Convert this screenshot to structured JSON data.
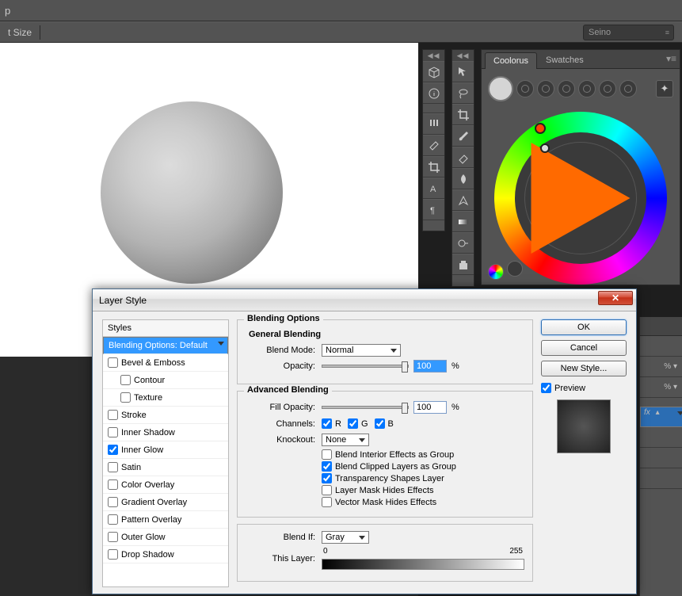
{
  "topbar": {
    "letter": "p",
    "tsize": "t Size"
  },
  "dropdown": {
    "seino": "Seino"
  },
  "panels": {
    "coolorus": "Coolorus",
    "swatches": "Swatches"
  },
  "dialog": {
    "title": "Layer Style",
    "close": "✕",
    "styles_header": "Styles",
    "style_items": {
      "blending": "Blending Options: Default",
      "bevel": "Bevel & Emboss",
      "contour": "Contour",
      "texture": "Texture",
      "stroke": "Stroke",
      "innershadow": "Inner Shadow",
      "innerglow": "Inner Glow",
      "satin": "Satin",
      "coloroverlay": "Color Overlay",
      "gradientoverlay": "Gradient Overlay",
      "patternoverlay": "Pattern Overlay",
      "outerglow": "Outer Glow",
      "dropshadow": "Drop Shadow"
    },
    "blending_options_title": "Blending Options",
    "general_title": "General Blending",
    "blendmode_label": "Blend Mode:",
    "blendmode_value": "Normal",
    "opacity_label": "Opacity:",
    "opacity_value": "100",
    "pct": "%",
    "advanced_title": "Advanced Blending",
    "fillopacity_label": "Fill Opacity:",
    "fillopacity_value": "100",
    "channels_label": "Channels:",
    "ch_r": "R",
    "ch_g": "G",
    "ch_b": "B",
    "knockout_label": "Knockout:",
    "knockout_value": "None",
    "adv1": "Blend Interior Effects as Group",
    "adv2": "Blend Clipped Layers as Group",
    "adv3": "Transparency Shapes Layer",
    "adv4": "Layer Mask Hides Effects",
    "adv5": "Vector Mask Hides Effects",
    "blendif_label": "Blend If:",
    "blendif_value": "Gray",
    "thislayer": "This Layer:",
    "thislayer_lo": "0",
    "thislayer_hi": "255",
    "ok": "OK",
    "cancel": "Cancel",
    "newstyle": "New Style...",
    "preview": "Preview"
  },
  "layersfx": "fx"
}
